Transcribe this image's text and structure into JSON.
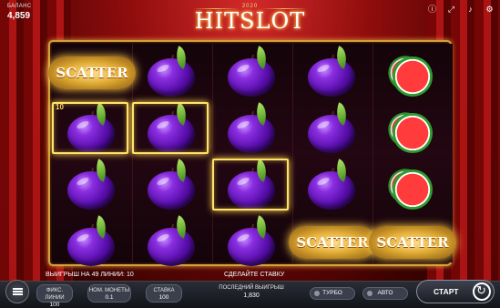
{
  "balance": {
    "label": "БАЛАНС",
    "value": "4,859"
  },
  "logo": {
    "year": "2020",
    "name": "HITSLOT"
  },
  "top_icons": [
    "info-icon",
    "fullscreen-icon",
    "sound-icon",
    "settings-icon"
  ],
  "reels": [
    [
      "scatter",
      "plum",
      "plum",
      "plum"
    ],
    [
      "plum",
      "plum",
      "plum",
      "plum"
    ],
    [
      "plum",
      "plum",
      "plum",
      "plum"
    ],
    [
      "plum",
      "plum",
      "plum",
      "scatter"
    ],
    [
      "watermelon",
      "watermelon",
      "watermelon",
      "scatter"
    ]
  ],
  "scatter_text": "SCATTER",
  "win_line_number": "10",
  "win_info": "ВЫИГРЫШ НА 49 ЛИНИИ: 10",
  "prompt": "СДЕЛАЙТЕ СТАВКУ",
  "controls": {
    "lines": {
      "label": "ФИКС. ЛИНИИ",
      "value": "100"
    },
    "coin": {
      "label": "НОМ. МОНЕТЫ",
      "value": "0.1"
    },
    "bet": {
      "label": "СТАВКА",
      "value": "100"
    },
    "last_win": {
      "label": "ПОСЛЕДНИЙ ВЫИГРЫШ",
      "value": "1,830"
    },
    "turbo": "ТУРБО",
    "auto": "АВТО",
    "start": "СТАРТ"
  },
  "colors": {
    "frame_gold": "#d49f3c",
    "win_highlight": "#ffe36b",
    "plum": "#5a0fae"
  }
}
